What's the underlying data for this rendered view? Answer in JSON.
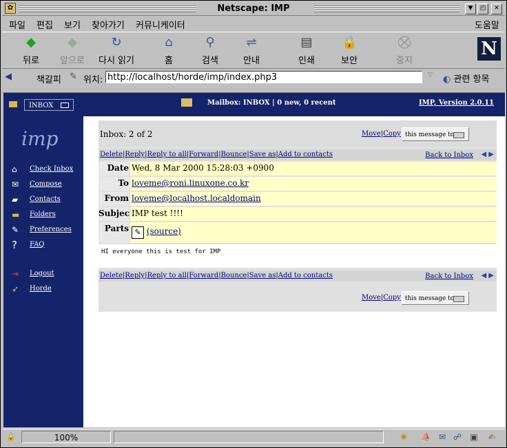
{
  "window": {
    "title": "Netscape: IMP"
  },
  "menu": [
    "파일",
    "편집",
    "보기",
    "찾아가기",
    "커뮤니케이터",
    "도움말"
  ],
  "toolbar": {
    "back": "뒤로",
    "forward": "앞으로",
    "reload": "다시 읽기",
    "home": "홈",
    "search": "검색",
    "guide": "안내",
    "print": "인쇄",
    "security": "보안",
    "stop": "중지"
  },
  "locbar": {
    "bookmarks": "책갈피",
    "location_label": "위치:",
    "url": "http://localhost/horde/imp/index.php3",
    "related": "관련 항목"
  },
  "imp": {
    "folder_select": "INBOX",
    "mailbox_info": "Mailbox: INBOX | 0 new, 0 recent",
    "version": "IMP, Version 2.0.11",
    "logo": "imp",
    "nav": [
      "Check Inbox",
      "Compose",
      "Contacts",
      "Folders",
      "Preferences",
      "FAQ",
      "Logout",
      "Horde"
    ],
    "inbox_count": "Inbox: 2 of 2",
    "move": "Move",
    "copy": "Copy",
    "this_message_to": "this message to:",
    "actions": [
      "Delete",
      "Reply",
      "Reply to all",
      "Forward",
      "Bounce",
      "Save as",
      "Add to contacts"
    ],
    "back_to_inbox": "Back to Inbox",
    "headers": {
      "date_label": "Date",
      "date": "Wed, 8 Mar 2000 15:28:03 +0900",
      "to_label": "To",
      "to": "loveme@roni.linuxone.co.kr",
      "from_label": "From",
      "from": "loveme@localhost.localdomain",
      "subject_label": "Subject",
      "subject": "IMP test !!!!",
      "parts_label": "Parts",
      "parts": "(source)"
    },
    "body": "HI everyone this is test for IMP"
  },
  "status": {
    "zoom": "100%"
  },
  "colors": {
    "imp_nav": "#14246a",
    "header_value_bg": "#ffffc8"
  }
}
